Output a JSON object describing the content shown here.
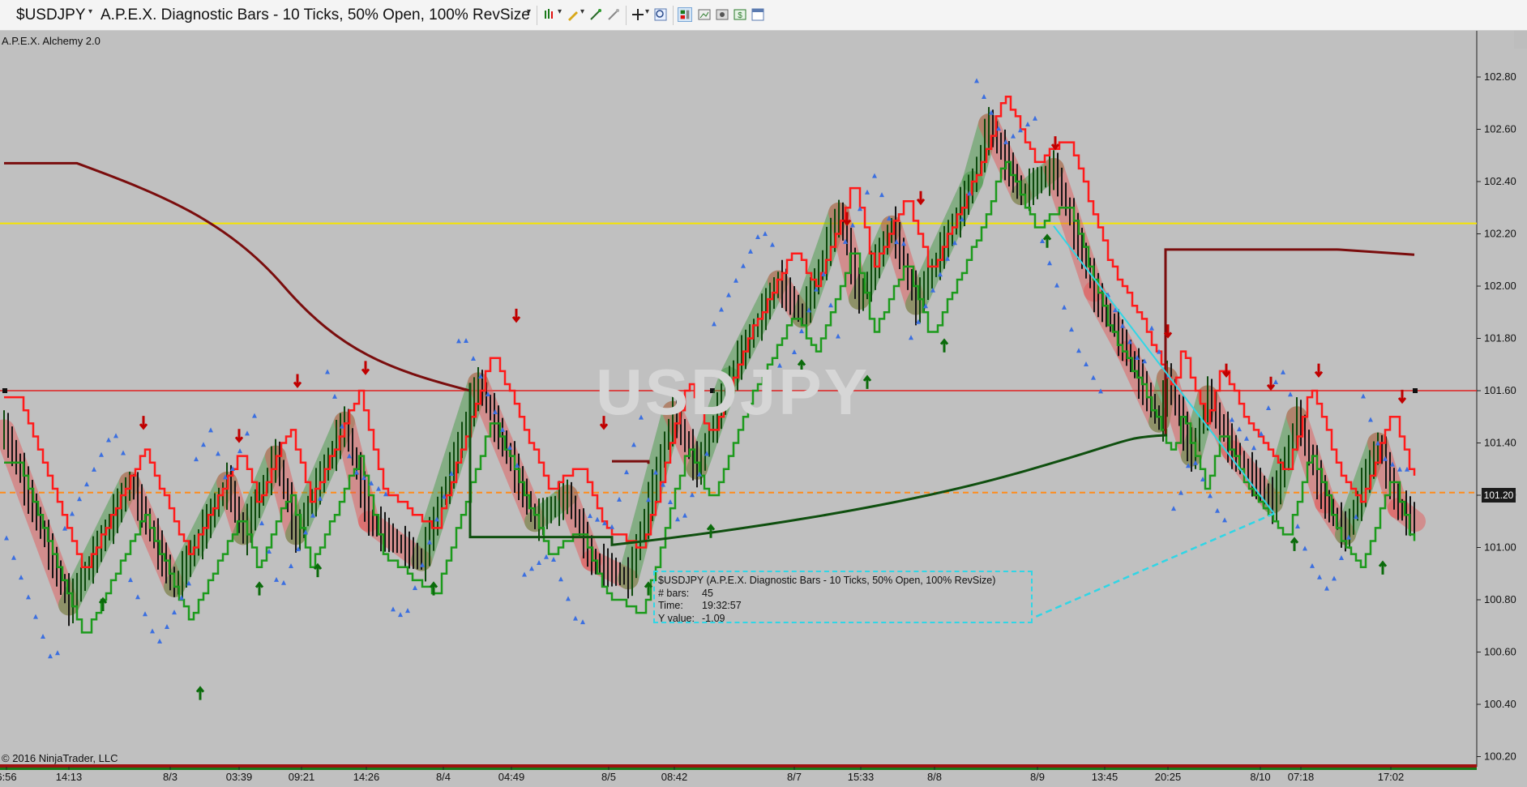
{
  "toolbar": {
    "instrument": "$USDJPY",
    "bar_type": "A.P.E.X. Diagnostic Bars - 10 Ticks, 50% Open, 100% RevSize",
    "icons": [
      "bar-style-icon",
      "draw-pencil-icon",
      "indicator-wand-icon",
      "strategy-wand-icon",
      "crosshair-icon",
      "zoom-icon",
      "chart-trader-icon",
      "screenshot-icon",
      "image-icon",
      "dollar-icon",
      "window-icon"
    ]
  },
  "chart": {
    "indicator_name": "A.P.E.X. Alchemy 2.0",
    "watermark": "USDJPY",
    "copyright": "© 2016 NinjaTrader, LLC",
    "current_price": "101.20",
    "price_labels": [
      "102.80",
      "102.60",
      "102.40",
      "102.20",
      "102.00",
      "101.80",
      "101.60",
      "101.40",
      "101.20",
      "101.00",
      "100.80",
      "100.60",
      "100.40",
      "100.20"
    ],
    "time_labels": [
      "6:56",
      "14:13",
      "8/3",
      "03:39",
      "09:21",
      "14:26",
      "8/4",
      "04:49",
      "8/5",
      "08:42",
      "8/7",
      "15:33",
      "8/8",
      "8/9",
      "13:45",
      "20:25",
      "8/10",
      "07:18",
      "17:02"
    ],
    "colors": {
      "background": "#c0c0c0",
      "up_bar": "#1a7a1a",
      "down_bar": "#e01010",
      "trail_red": "#ff1a1a",
      "trail_green": "#1c9a1c",
      "dots": "#3b6fe0",
      "maroon_line": "#7a0d0d",
      "dark_green_line": "#0f4f0f",
      "yellow_line": "#f5e400",
      "red_line": "#e02020",
      "orange_dashed": "#ff8c1a",
      "cyan_line": "#2fd6e6"
    }
  },
  "tooltip": {
    "title": "$USDJPY (A.P.E.X. Diagnostic Bars - 10 Ticks, 50% Open, 100% RevSize)",
    "bars_label": "# bars:",
    "bars_value": "45",
    "time_label": "Time:",
    "time_value": "19:32:57",
    "y_label": "Y value:",
    "y_value": "-1.09"
  }
}
